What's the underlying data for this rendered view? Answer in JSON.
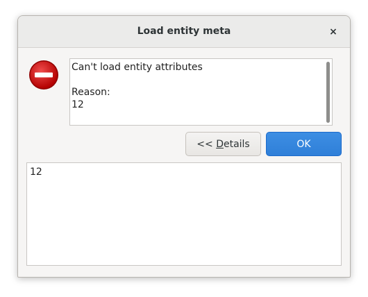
{
  "window": {
    "title": "Load entity meta",
    "close_glyph": "×"
  },
  "icon": {
    "name": "error-icon",
    "color": "#cc0000"
  },
  "message": {
    "line1": "Can't load entity attributes",
    "reason_label": "Reason:",
    "reason_value": "12"
  },
  "buttons": {
    "details_prefix": "<< ",
    "details_mnemonic": "D",
    "details_rest": "etails",
    "ok_label": "OK"
  },
  "details_text": "12",
  "colors": {
    "accent": "#3584e4",
    "error": "#cc0000"
  }
}
